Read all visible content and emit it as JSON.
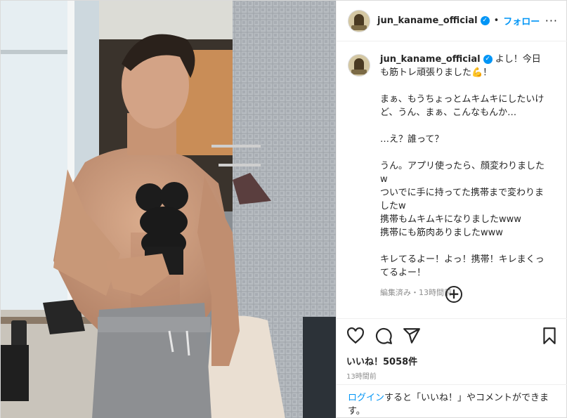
{
  "header": {
    "username": "jun_kaname_official",
    "separator": "•",
    "follow_label": "フォロー",
    "more_label": "···"
  },
  "caption": {
    "username": "jun_kaname_official",
    "text": "よし！今日も筋トレ頑張りました💪！\n\nまぁ、もうちょっとムキムキにしたいけど、うん、まぁ、こんなもんか…\n\n…え？誰って？\n\nうん。アプリ使ったら、顔変わりましたw\nついでに手に持ってた携帯まで変わりましたw\n携帯もムキムキになりましたwww\n携帯にも筋肉ありましたwww\n\nキレてるよー！よっ！携帯！キレまくってるよー！",
    "meta": "編集済み・13時間前"
  },
  "actions": {
    "likes": "いいね！5058件",
    "time": "13時間前"
  },
  "login": {
    "link": "ログイン",
    "rest": "すると「いいね！」やコメントができます。"
  },
  "colors": {
    "accent": "#0095f6",
    "text": "#262626",
    "muted": "#8e8e8e",
    "border": "#efefef"
  },
  "icons": [
    "verified-badge-icon",
    "more-options-icon",
    "add-comment-icon",
    "heart-icon",
    "comment-icon",
    "share-icon",
    "bookmark-icon"
  ]
}
